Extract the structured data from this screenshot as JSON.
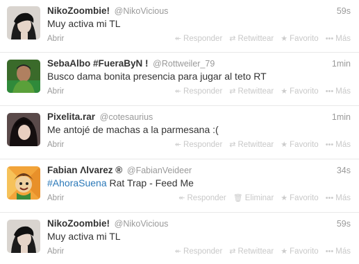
{
  "tweets": [
    {
      "fullname": "NikoZoombie!",
      "username": "@NikoVicious",
      "time": "59s",
      "text": "Muy activa mi TL",
      "expand": "Abrir",
      "actions": {
        "reply": "Responder",
        "second": "Retwittear",
        "favorite": "Favorito",
        "more": "Más"
      },
      "second_icon": "retweet-icon"
    },
    {
      "fullname": "SebaAlbo #FueraByN !",
      "username": "@Rottweiler_79",
      "time": "1min",
      "text": "Busco dama bonita presencia para jugar al teto RT",
      "expand": "Abrir",
      "actions": {
        "reply": "Responder",
        "second": "Retwittear",
        "favorite": "Favorito",
        "more": "Más"
      },
      "second_icon": "retweet-icon"
    },
    {
      "fullname": "Pixelita.rar",
      "username": "@cotesaurius",
      "time": "1min",
      "text": "Me antojé de machas a la parmesana :(",
      "expand": "Abrir",
      "actions": {
        "reply": "Responder",
        "second": "Retwittear",
        "favorite": "Favorito",
        "more": "Más"
      },
      "second_icon": "retweet-icon"
    },
    {
      "fullname": "Fabian Λlvarez ®",
      "username": "@FabianVeideer",
      "time": "34s",
      "hashtag": "#AhoraSuena",
      "text": " Rat Trap - Feed Me",
      "expand": "Abrir",
      "actions": {
        "reply": "Responder",
        "second": "Eliminar",
        "favorite": "Favorito",
        "more": "Más"
      },
      "second_icon": "trash-icon"
    },
    {
      "fullname": "NikoZoombie!",
      "username": "@NikoVicious",
      "time": "59s",
      "text": "Muy activa mi TL",
      "expand": "Abrir",
      "actions": {
        "reply": "Responder",
        "second": "Retwittear",
        "favorite": "Favorito",
        "more": "Más"
      },
      "second_icon": "retweet-icon"
    }
  ]
}
